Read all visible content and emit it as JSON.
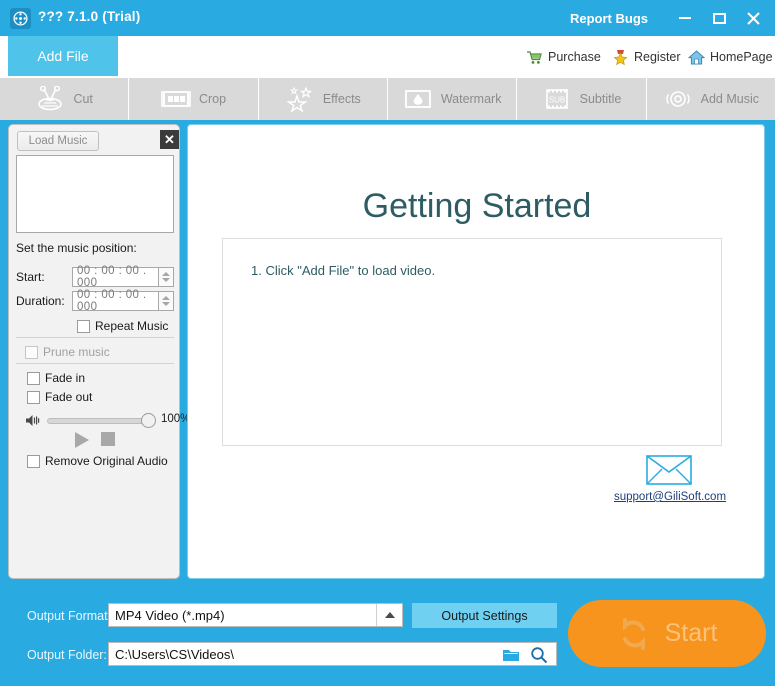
{
  "window": {
    "title": "??? 7.1.0 (Trial)",
    "app_icon": "film-reel-icon",
    "report_bugs": "Report Bugs",
    "minimize": "minimize-icon",
    "maximize": "maximize-icon",
    "close": "close-icon",
    "accent_color": "#29abe2"
  },
  "toolbar": {
    "add_file": "Add File",
    "links": [
      {
        "label": "Purchase",
        "icon": "shopping-cart-icon"
      },
      {
        "label": "Register",
        "icon": "star-medal-icon"
      },
      {
        "label": "HomePage",
        "icon": "house-icon"
      }
    ]
  },
  "tabs": [
    {
      "label": "Cut",
      "icon": "scissors-icon",
      "active": false
    },
    {
      "label": "Crop",
      "icon": "filmstrip-grid-icon",
      "active": false
    },
    {
      "label": "Effects",
      "icon": "stars-icon",
      "active": false
    },
    {
      "label": "Watermark",
      "icon": "droplet-frame-icon",
      "active": false
    },
    {
      "label": "Subtitle",
      "icon": "sub-filmstrip-icon",
      "active": false
    },
    {
      "label": "Add Music",
      "icon": "speaker-waves-icon",
      "active": true
    }
  ],
  "music_panel": {
    "load_music": "Load Music",
    "close_icon": "close-x-icon",
    "music_list_items": [],
    "position_label": "Set the music position:",
    "start_label": "Start:",
    "start_value": "00 : 00 : 00 . 000",
    "duration_label": "Duration:",
    "duration_value": "00 : 00 : 00 . 000",
    "repeat_music": "Repeat Music",
    "prune_music": "Prune music",
    "fade_in": "Fade in",
    "fade_out": "Fade out",
    "volume_value": "100%",
    "volume_icon": "speaker-icon",
    "play_icon": "play-icon",
    "stop_icon": "stop-icon",
    "remove_original_audio": "Remove Original Audio"
  },
  "content": {
    "heading": "Getting Started",
    "steps": [
      "1. Click \"Add File\" to load video."
    ],
    "email_icon": "envelope-icon",
    "email": "support@GiliSoft.com",
    "heading_color": "#2e5c63"
  },
  "bottom": {
    "format_label": "Output Format:",
    "format_value": "MP4 Video (*.mp4)",
    "format_arrow": "chevron-up-icon",
    "output_settings": "Output Settings",
    "folder_label": "Output Folder:",
    "folder_value": "C:\\Users\\CS\\Videos\\",
    "folder_icon": "folder-icon",
    "search_icon": "magnifier-icon",
    "start_label": "Start",
    "start_icon": "refresh-icon",
    "start_color": "#f7941e"
  }
}
